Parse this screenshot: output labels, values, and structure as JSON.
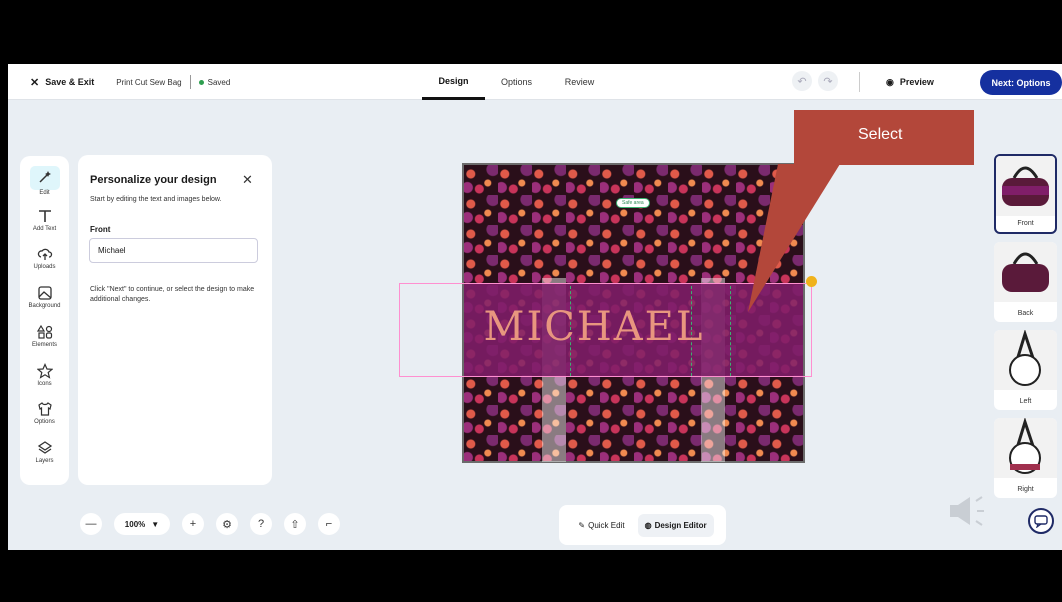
{
  "header": {
    "save_exit": "Save & Exit",
    "doc_name": "Print Cut Sew Bag",
    "status": "Saved",
    "tabs": [
      {
        "label": "Design"
      },
      {
        "label": "Options"
      },
      {
        "label": "Review"
      }
    ],
    "preview": "Preview",
    "next": "Next: Options"
  },
  "toolbar": {
    "items": [
      {
        "label": "Edit"
      },
      {
        "label": "Add Text"
      },
      {
        "label": "Uploads"
      },
      {
        "label": "Background"
      },
      {
        "label": "Elements"
      },
      {
        "label": "Icons"
      },
      {
        "label": "Options"
      },
      {
        "label": "Layers"
      }
    ]
  },
  "panel": {
    "title": "Personalize your design",
    "subtitle": "Start by editing the text and images below.",
    "field_label": "Front",
    "field_value": "Michael",
    "hint": "Click \"Next\" to continue, or select the design to make additional changes."
  },
  "canvas": {
    "safe_area": "Safe area",
    "text": "MICHAEL"
  },
  "callout": {
    "text": "Select"
  },
  "views": [
    {
      "label": "Front"
    },
    {
      "label": "Back"
    },
    {
      "label": "Left"
    },
    {
      "label": "Right"
    }
  ],
  "bottom": {
    "zoom": "100%",
    "quick_edit": "Quick Edit",
    "design_editor": "Design Editor"
  },
  "colors": {
    "accent": "#15309f",
    "callout": "#b3473a",
    "band": "#801e69",
    "text": "#e8967f"
  }
}
